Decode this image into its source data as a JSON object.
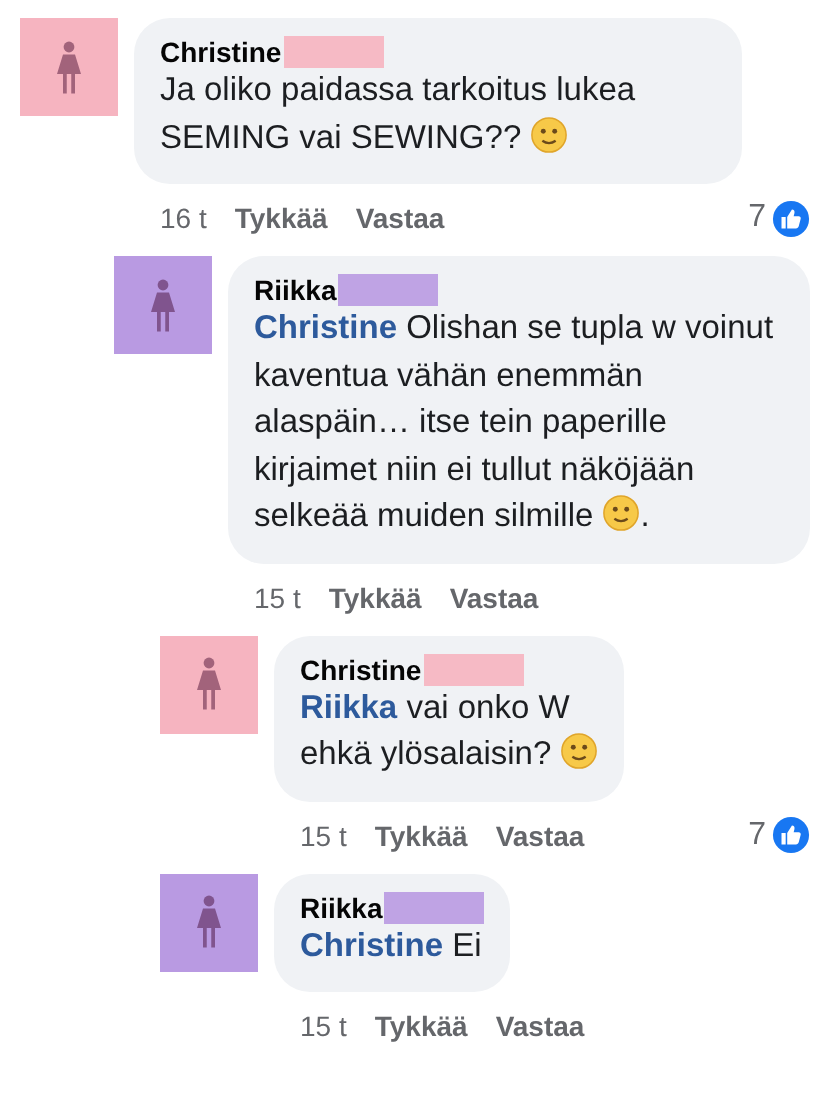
{
  "comments": [
    {
      "author": {
        "name": "Christine",
        "color": "#f6b4c0"
      },
      "body": [
        {
          "kind": "text",
          "text": "Ja oliko paidassa tarkoitus lukea SEMING  vai SEWING?? "
        },
        {
          "kind": "emoji"
        }
      ],
      "time": "16 t",
      "actions": [
        "Tykkää",
        "Vastaa"
      ],
      "likes": "7",
      "children": [
        {
          "author": {
            "name": "Riikka",
            "color": "#b99ae2"
          },
          "body": [
            {
              "kind": "mention",
              "text": "Christine"
            },
            {
              "kind": "text",
              "text": " Olishan se tupla w voinut kaventua vähän enemmän alaspäin… itse tein paperille kirjaimet niin ei tullut näköjään selkeää muiden silmille "
            },
            {
              "kind": "emoji"
            },
            {
              "kind": "text",
              "text": "."
            }
          ],
          "time": "15 t",
          "actions": [
            "Tykkää",
            "Vastaa"
          ],
          "children": [
            {
              "author": {
                "name": "Christine",
                "color": "#f6b4c0"
              },
              "body": [
                {
                  "kind": "mention",
                  "text": "Riikka"
                },
                {
                  "kind": "text",
                  "text": " vai onko W\nehkä ylösalaisin? "
                },
                {
                  "kind": "emoji"
                }
              ],
              "time": "15 t",
              "actions": [
                "Tykkää",
                "Vastaa"
              ],
              "likes": "7"
            },
            {
              "author": {
                "name": "Riikka",
                "color": "#b99ae2"
              },
              "body": [
                {
                  "kind": "mention",
                  "text": "Christine"
                },
                {
                  "kind": "text",
                  "text": " Ei"
                }
              ],
              "time": "15 t",
              "actions": [
                "Tykkää",
                "Vastaa"
              ]
            }
          ]
        }
      ]
    }
  ]
}
